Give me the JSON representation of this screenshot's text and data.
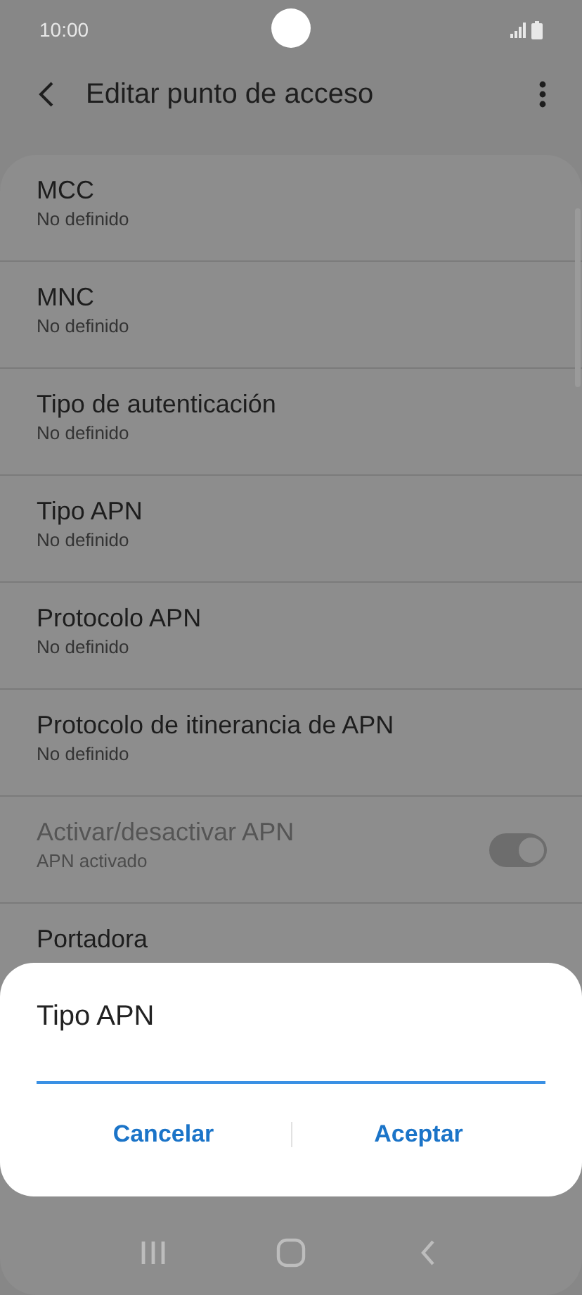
{
  "status_bar": {
    "time": "10:00"
  },
  "header": {
    "title": "Editar punto de acceso"
  },
  "settings": [
    {
      "kind": "text",
      "title": "MCC",
      "subtitle": "No definido",
      "disabled": false
    },
    {
      "kind": "text",
      "title": "MNC",
      "subtitle": "No definido",
      "disabled": false
    },
    {
      "kind": "text",
      "title": "Tipo de autenticación",
      "subtitle": "No definido",
      "disabled": false
    },
    {
      "kind": "text",
      "title": "Tipo APN",
      "subtitle": "No definido",
      "disabled": false
    },
    {
      "kind": "text",
      "title": "Protocolo APN",
      "subtitle": "No definido",
      "disabled": false
    },
    {
      "kind": "text",
      "title": "Protocolo de itinerancia de APN",
      "subtitle": "No definido",
      "disabled": false
    },
    {
      "kind": "switch",
      "title": "Activar/desactivar APN",
      "subtitle": "APN activado",
      "disabled": true,
      "on": true
    },
    {
      "kind": "text",
      "title": "Portadora",
      "disabled": false
    }
  ],
  "dialog": {
    "title": "Tipo APN",
    "buttons": [
      "Cancelar",
      "Aceptar"
    ]
  }
}
